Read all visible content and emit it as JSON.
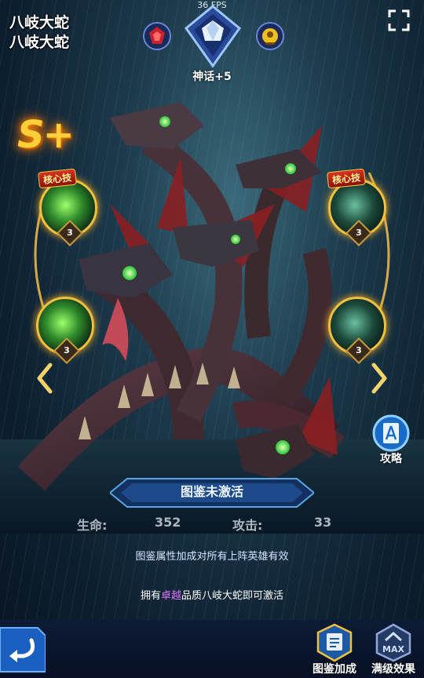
{
  "hero": {
    "title_line1": "八岐大蛇",
    "title_line2": "八岐大蛇",
    "rank_label": "神话+5",
    "grade": "S+"
  },
  "fps": "36 FPS",
  "skills": {
    "core_tag": "核心技",
    "levels": [
      "3",
      "3",
      "3",
      "3"
    ]
  },
  "guide_label": "攻略",
  "codex": {
    "status": "图鉴未激活",
    "hp_label": "生命:",
    "hp_value": "352",
    "atk_label": "攻击:",
    "atk_value": "33",
    "note1": "图鉴属性加成对所有上阵英雄有效",
    "note2_prefix": "拥有",
    "note2_highlight": "卓越",
    "note2_suffix": "品质八岐大蛇即可激活"
  },
  "bottom": {
    "bonus_label": "图鉴加成",
    "max_label": "满级效果"
  },
  "colors": {
    "gold": "#f0c040",
    "highlight": "#e070ff",
    "grade": "#ffcf3a"
  },
  "icons": [
    "faction-red-emblem-icon",
    "rank-crystal-icon",
    "faction-gold-emblem-icon",
    "fullscreen-icon",
    "left-arrow-icon",
    "right-arrow-icon",
    "guide-book-icon",
    "back-arrow-icon",
    "codex-bonus-icon",
    "max-level-icon"
  ]
}
